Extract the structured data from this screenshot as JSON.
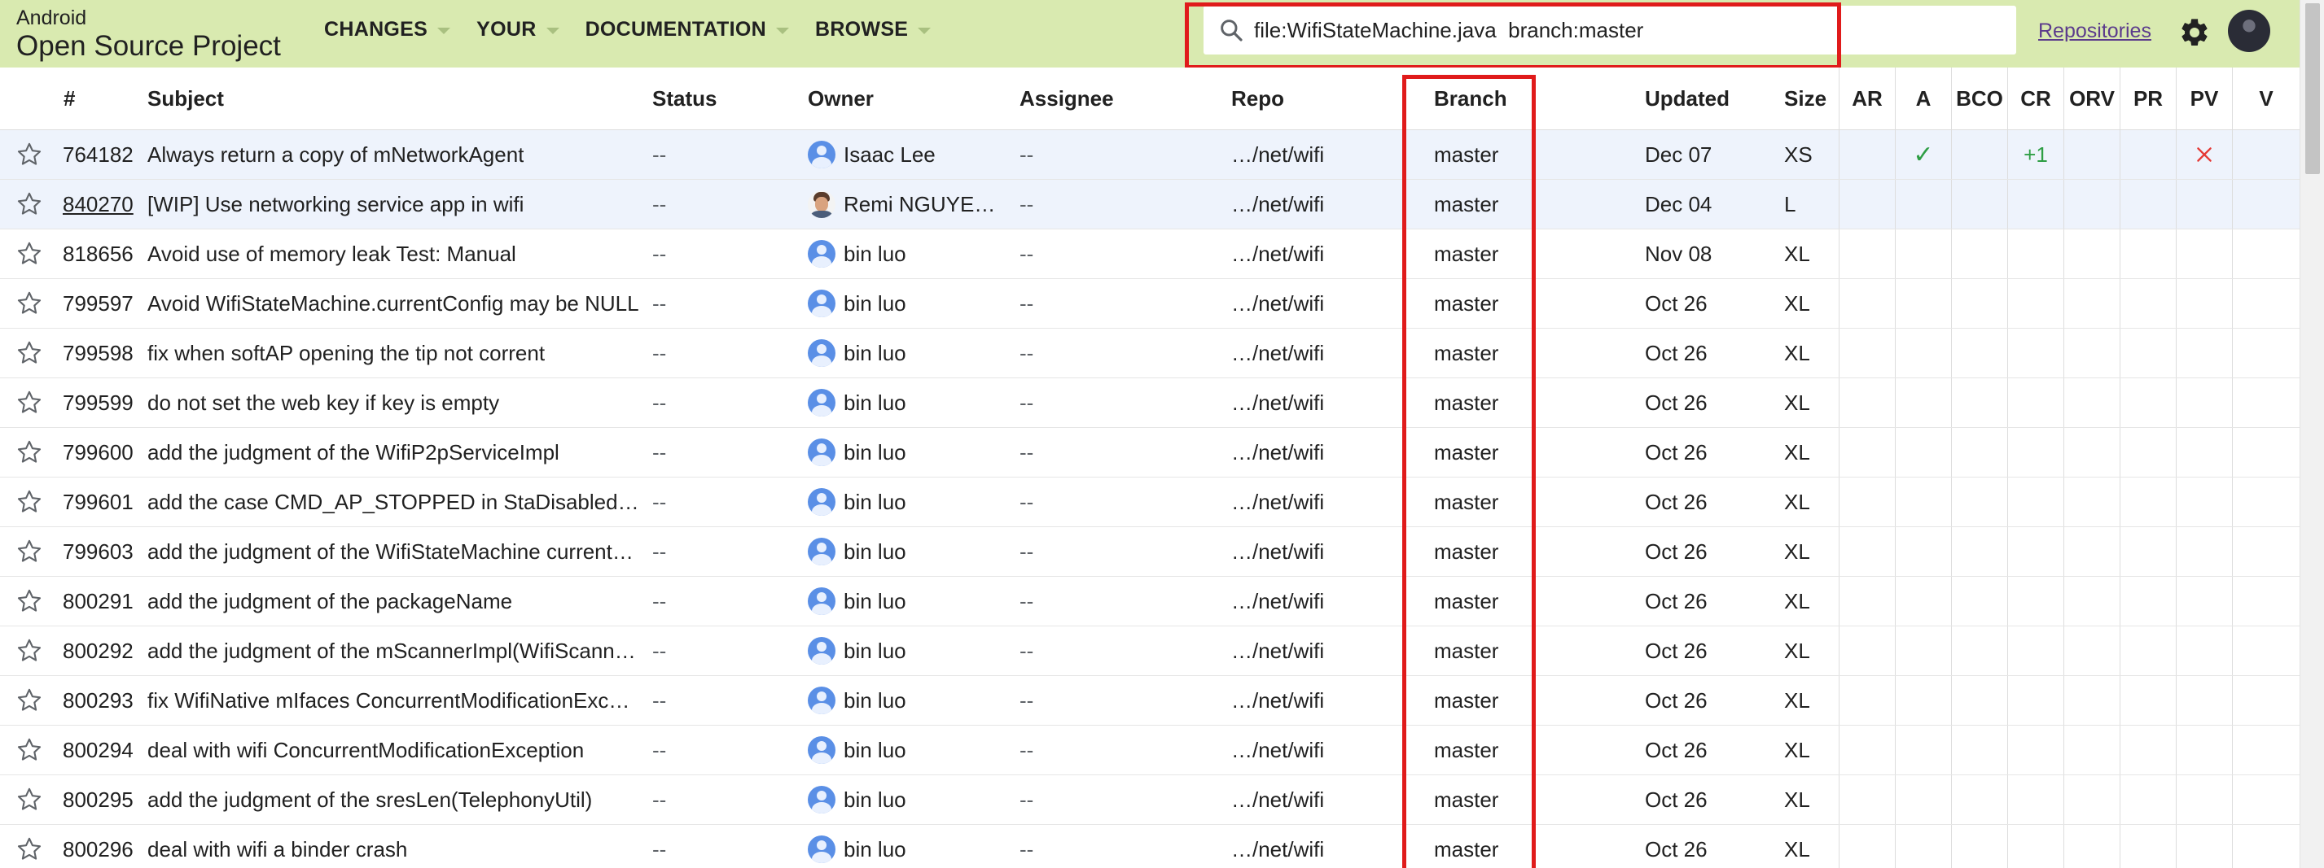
{
  "header": {
    "brand_small": "Android",
    "brand_big": "Open Source Project",
    "nav": [
      "CHANGES",
      "YOUR",
      "DOCUMENTATION",
      "BROWSE"
    ],
    "search_value": "file:WifiStateMachine.java  branch:master",
    "repositories_label": "Repositories"
  },
  "columns": {
    "number": "#",
    "subject": "Subject",
    "status": "Status",
    "owner": "Owner",
    "assignee": "Assignee",
    "repo": "Repo",
    "branch": "Branch",
    "updated": "Updated",
    "size": "Size",
    "labels": [
      "AR",
      "A",
      "BCO",
      "CR",
      "ORV",
      "PR",
      "PV",
      "V"
    ]
  },
  "rows": [
    {
      "number": "764182",
      "subject": "Always return a copy of mNetworkAgent",
      "status": "--",
      "owner": "Isaac Lee",
      "assignee": "--",
      "repo": "…/net/wifi",
      "branch": "master",
      "updated": "Dec 07",
      "size": "XS",
      "A": "✓",
      "CR": "+1",
      "PV": "rejected"
    },
    {
      "number": "840270",
      "subject": "[WIP] Use networking service app in wifi",
      "status": "--",
      "owner": "Remi NGUYEN …",
      "assignee": "--",
      "repo": "…/net/wifi",
      "branch": "master",
      "updated": "Dec 04",
      "size": "L"
    },
    {
      "number": "818656",
      "subject": "Avoid use of memory leak Test: Manual",
      "status": "--",
      "owner": "bin luo",
      "assignee": "--",
      "repo": "…/net/wifi",
      "branch": "master",
      "updated": "Nov 08",
      "size": "XL"
    },
    {
      "number": "799597",
      "subject": "Avoid WifiStateMachine.currentConfig may be NULL",
      "status": "--",
      "owner": "bin luo",
      "assignee": "--",
      "repo": "…/net/wifi",
      "branch": "master",
      "updated": "Oct 26",
      "size": "XL"
    },
    {
      "number": "799598",
      "subject": "fix when softAP opening the tip not corrent",
      "status": "--",
      "owner": "bin luo",
      "assignee": "--",
      "repo": "…/net/wifi",
      "branch": "master",
      "updated": "Oct 26",
      "size": "XL"
    },
    {
      "number": "799599",
      "subject": "do not set the web key if key is empty",
      "status": "--",
      "owner": "bin luo",
      "assignee": "--",
      "repo": "…/net/wifi",
      "branch": "master",
      "updated": "Oct 26",
      "size": "XL"
    },
    {
      "number": "799600",
      "subject": "add the judgment of the WifiP2pServiceImpl",
      "status": "--",
      "owner": "bin luo",
      "assignee": "--",
      "repo": "…/net/wifi",
      "branch": "master",
      "updated": "Oct 26",
      "size": "XL"
    },
    {
      "number": "799601",
      "subject": "add the case CMD_AP_STOPPED in StaDisabledWi…",
      "status": "--",
      "owner": "bin luo",
      "assignee": "--",
      "repo": "…/net/wifi",
      "branch": "master",
      "updated": "Oct 26",
      "size": "XL"
    },
    {
      "number": "799603",
      "subject": "add the judgment of the WifiStateMachine current…",
      "status": "--",
      "owner": "bin luo",
      "assignee": "--",
      "repo": "…/net/wifi",
      "branch": "master",
      "updated": "Oct 26",
      "size": "XL"
    },
    {
      "number": "800291",
      "subject": "add the judgment of the packageName",
      "status": "--",
      "owner": "bin luo",
      "assignee": "--",
      "repo": "…/net/wifi",
      "branch": "master",
      "updated": "Oct 26",
      "size": "XL"
    },
    {
      "number": "800292",
      "subject": "add the judgment of the mScannerImpl(WifiScanni…",
      "status": "--",
      "owner": "bin luo",
      "assignee": "--",
      "repo": "…/net/wifi",
      "branch": "master",
      "updated": "Oct 26",
      "size": "XL"
    },
    {
      "number": "800293",
      "subject": "fix WifiNative mIfaces ConcurrentModificationExce…",
      "status": "--",
      "owner": "bin luo",
      "assignee": "--",
      "repo": "…/net/wifi",
      "branch": "master",
      "updated": "Oct 26",
      "size": "XL"
    },
    {
      "number": "800294",
      "subject": "deal with wifi ConcurrentModificationException",
      "status": "--",
      "owner": "bin luo",
      "assignee": "--",
      "repo": "…/net/wifi",
      "branch": "master",
      "updated": "Oct 26",
      "size": "XL"
    },
    {
      "number": "800295",
      "subject": "add the judgment of the sresLen(TelephonyUtil)",
      "status": "--",
      "owner": "bin luo",
      "assignee": "--",
      "repo": "…/net/wifi",
      "branch": "master",
      "updated": "Oct 26",
      "size": "XL"
    },
    {
      "number": "800296",
      "subject": "deal with wifi a binder crash",
      "status": "--",
      "owner": "bin luo",
      "assignee": "--",
      "repo": "…/net/wifi",
      "branch": "master",
      "updated": "Oct 26",
      "size": "XL"
    }
  ],
  "colors": {
    "header_bg": "#d9eab0",
    "highlight": "#e01b1b",
    "approved": "#2e9e44",
    "rejected": "#e53935",
    "row_shade": "#eef3fc"
  }
}
